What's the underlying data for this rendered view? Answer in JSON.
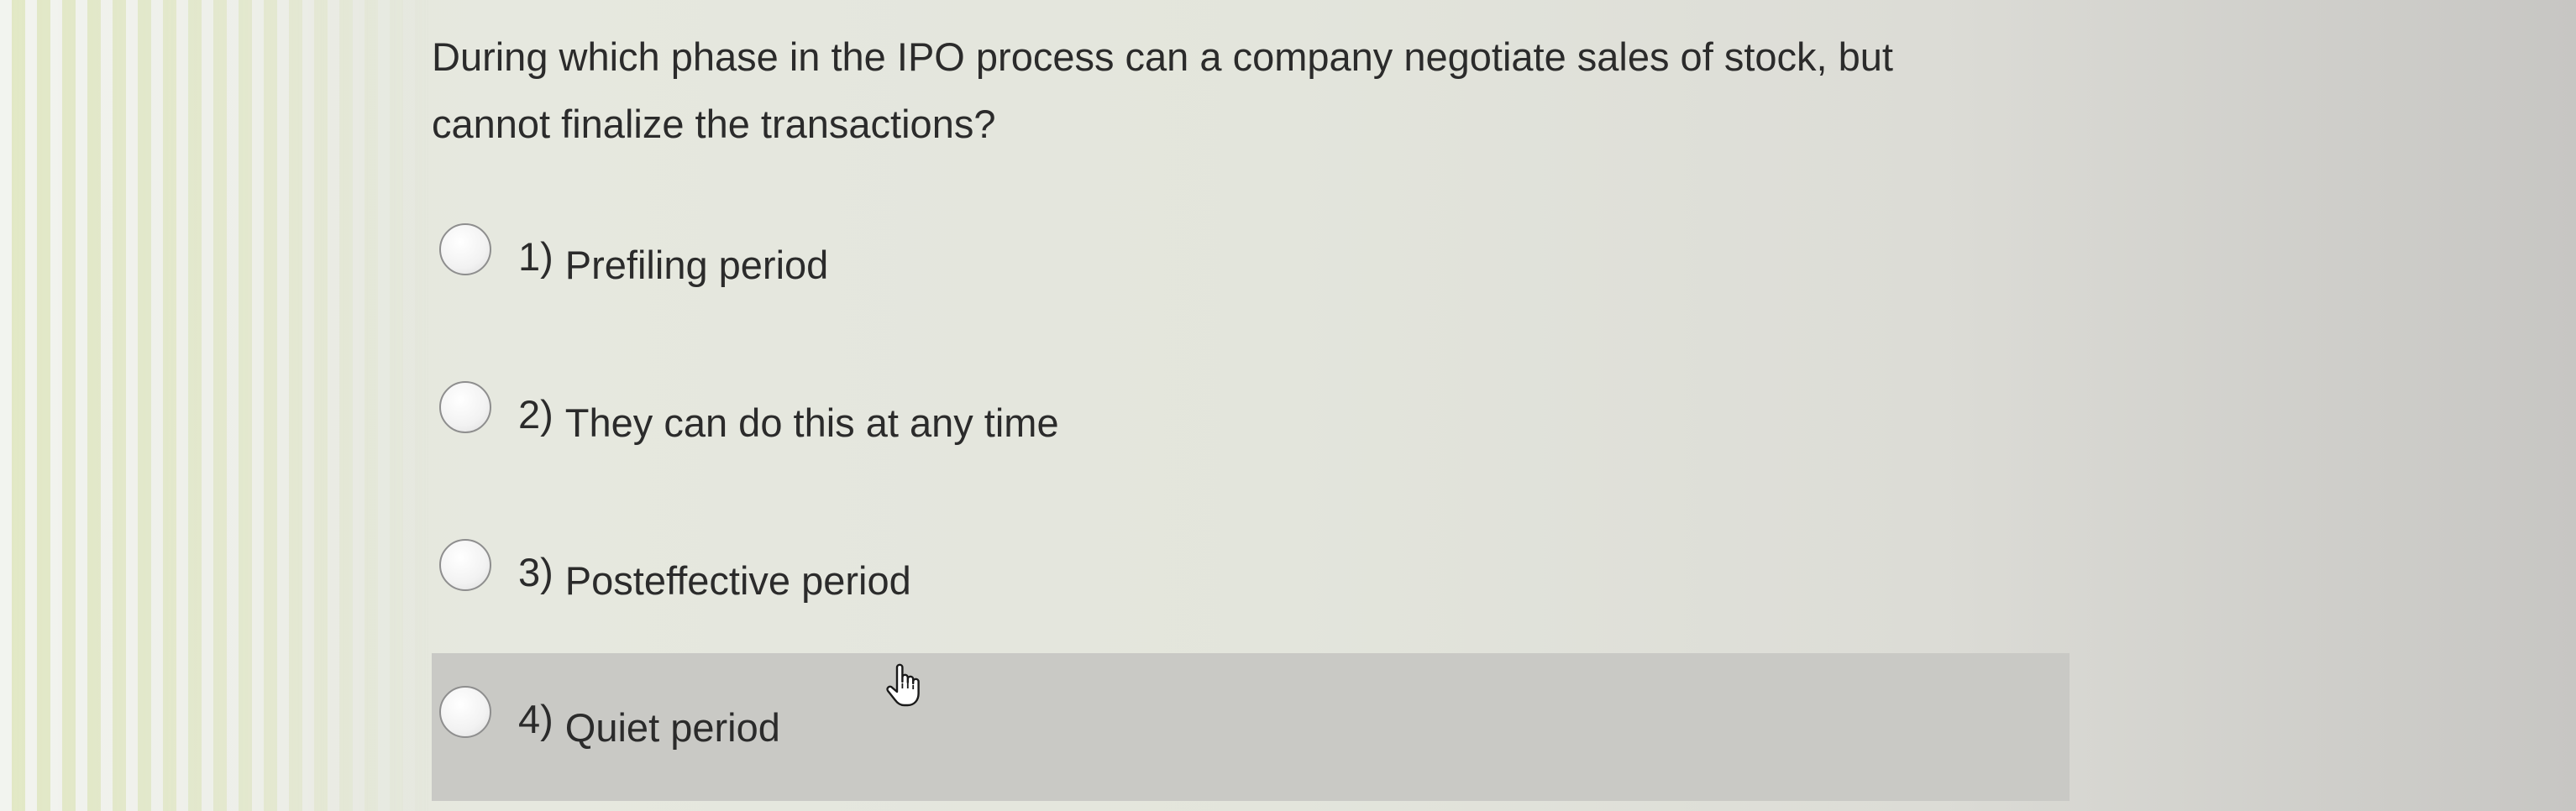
{
  "question": {
    "line1": "During which phase in the IPO process can a company negotiate sales of stock, but",
    "line2": "cannot finalize the transactions?"
  },
  "options": [
    {
      "number": "1)",
      "label": "Prefiling period",
      "selected": false
    },
    {
      "number": "2)",
      "label": "They can do this at any time",
      "selected": false
    },
    {
      "number": "3)",
      "label": "Posteffective period",
      "selected": false
    },
    {
      "number": "4)",
      "label": "Quiet period",
      "selected": false,
      "hovered": true
    }
  ],
  "cursor": {
    "icon": "hand-pointer-icon"
  },
  "colors": {
    "text": "#2b2b2b",
    "hover_row": "#c9c9c5",
    "radio_border": "#8e8e8e"
  }
}
